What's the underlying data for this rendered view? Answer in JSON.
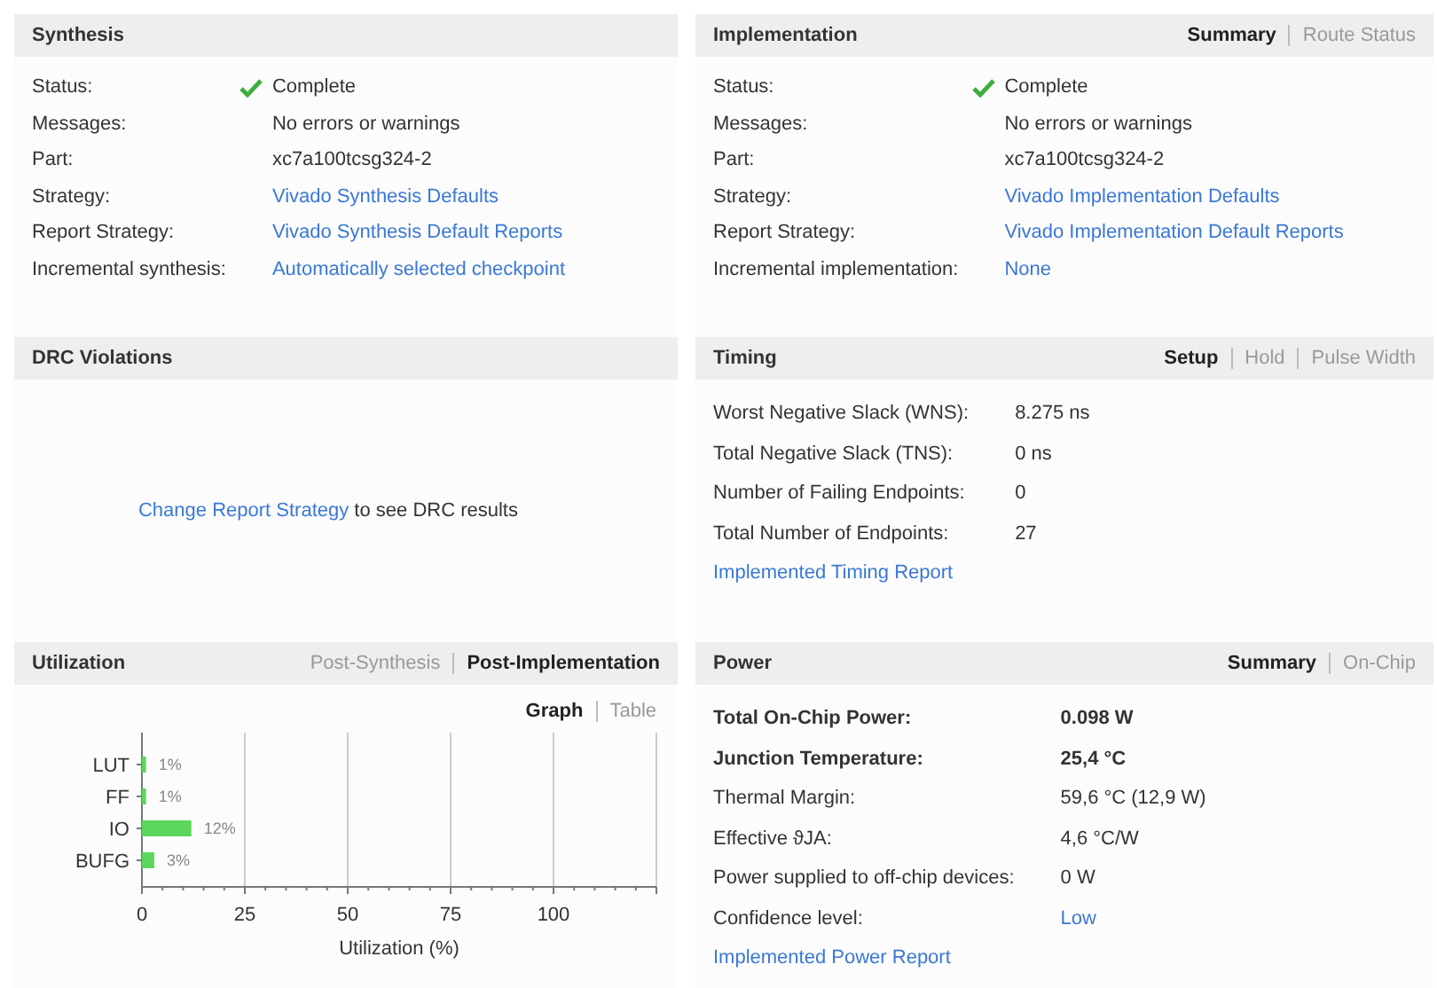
{
  "sections": [
    {
      "title": "Synthesis",
      "rows": [
        {
          "label": "Status:",
          "value": "Complete",
          "kind": "status"
        },
        {
          "label": "Messages:",
          "value": "No errors or warnings",
          "kind": "text"
        },
        {
          "label": "Part:",
          "value": "xc7a100tcsg324-2",
          "kind": "text"
        },
        {
          "label": "Strategy:",
          "value": "Vivado Synthesis Defaults",
          "kind": "link"
        },
        {
          "label": "Report Strategy:",
          "value": "Vivado Synthesis Default Reports",
          "kind": "link"
        },
        {
          "label": "Incremental synthesis:",
          "value": "Automatically selected checkpoint",
          "kind": "link"
        }
      ]
    },
    {
      "title": "Implementation",
      "tabs": [
        {
          "label": "Summary",
          "selected": true
        },
        {
          "label": "Route Status",
          "selected": false
        }
      ],
      "rows": [
        {
          "label": "Status:",
          "value": "Complete",
          "kind": "status"
        },
        {
          "label": "Messages:",
          "value": "No errors or warnings",
          "kind": "text"
        },
        {
          "label": "Part:",
          "value": "xc7a100tcsg324-2",
          "kind": "text"
        },
        {
          "label": "Strategy:",
          "value": "Vivado Implementation Defaults",
          "kind": "link"
        },
        {
          "label": "Report Strategy:",
          "value": "Vivado Implementation Default Reports",
          "kind": "link"
        },
        {
          "label": "Incremental implementation:",
          "value": "None",
          "kind": "link"
        }
      ]
    },
    {
      "title": "DRC Violations",
      "message": {
        "link": "Change Report Strategy",
        "text": " to see DRC results"
      }
    },
    {
      "title": "Timing",
      "tabs": [
        {
          "label": "Setup",
          "selected": true
        },
        {
          "label": "Hold",
          "selected": false
        },
        {
          "label": "Pulse Width",
          "selected": false
        }
      ],
      "rows": [
        {
          "label": "Worst Negative Slack (WNS):",
          "value": "8.275 ns",
          "kind": "text"
        },
        {
          "label": "Total Negative Slack (TNS):",
          "value": "0 ns",
          "kind": "text"
        },
        {
          "label": "Number of Failing Endpoints:",
          "value": "0",
          "kind": "text"
        },
        {
          "label": "Total Number of Endpoints:",
          "value": "27",
          "kind": "text"
        }
      ],
      "footer_link": "Implemented Timing Report"
    },
    {
      "title": "Utilization",
      "tabs": [
        {
          "label": "Post-Synthesis",
          "selected": false
        },
        {
          "label": "Post-Implementation",
          "selected": true
        }
      ],
      "view_tabs": [
        {
          "label": "Graph",
          "selected": true
        },
        {
          "label": "Table",
          "selected": false
        }
      ],
      "chart_data": {
        "type": "bar",
        "orientation": "horizontal",
        "xlabel": "Utilization (%)",
        "categories": [
          "LUT",
          "FF",
          "IO",
          "BUFG"
        ],
        "series": [
          {
            "color": "#5cd65c",
            "values": [
              1,
              1,
              12,
              3
            ]
          }
        ],
        "grid": true,
        "xlim": [
          0,
          125
        ],
        "xticks": [
          0,
          25,
          50,
          75,
          100
        ],
        "value_labels": [
          "1%",
          "1%",
          "12%",
          "3%"
        ]
      }
    },
    {
      "title": "Power",
      "tabs": [
        {
          "label": "Summary",
          "selected": true
        },
        {
          "label": "On-Chip",
          "selected": false
        }
      ],
      "rows": [
        {
          "label": "Total On-Chip Power:",
          "value": "0.098 W",
          "kind": "text",
          "bold": true
        },
        {
          "label": "Junction Temperature:",
          "value": "25,4 °C",
          "kind": "text",
          "bold": true
        },
        {
          "label": "Thermal Margin:",
          "value": "59,6 °C (12,9 W)",
          "kind": "text",
          "bold": false
        },
        {
          "label": "Effective ϑJA:",
          "value": "4,6 °C/W",
          "kind": "text",
          "bold": false
        },
        {
          "label": "Power supplied to off-chip devices:",
          "value": "0 W",
          "kind": "text",
          "bold": false
        },
        {
          "label": "Confidence level:",
          "value": "Low",
          "kind": "link",
          "bold": false
        }
      ],
      "footer_link": "Implemented Power Report"
    }
  ]
}
